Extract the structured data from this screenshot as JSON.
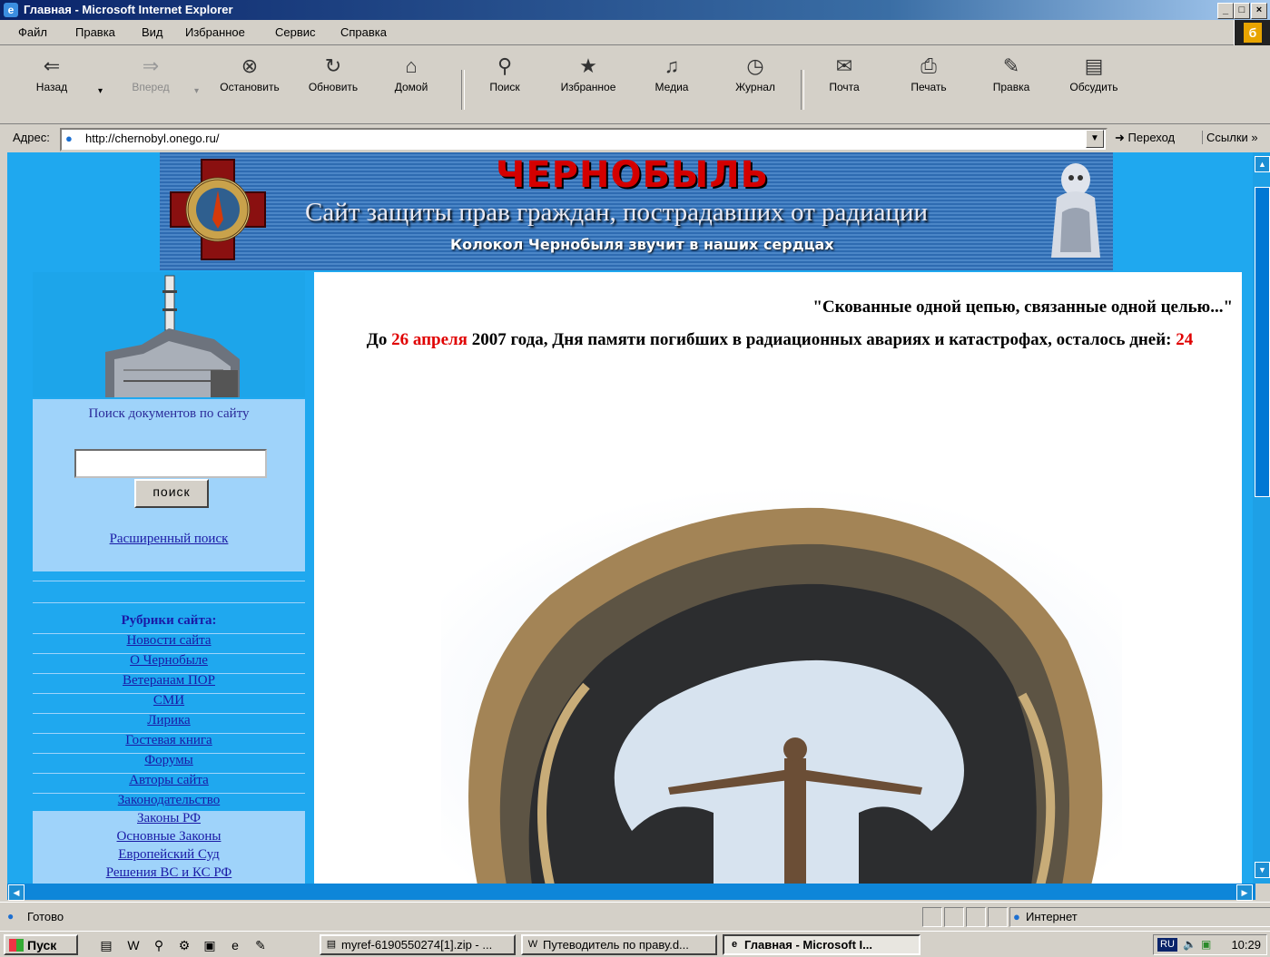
{
  "window": {
    "title": "Главная - Microsoft Internet Explorer"
  },
  "menu": [
    "Файл",
    "Правка",
    "Вид",
    "Избранное",
    "Сервис",
    "Справка"
  ],
  "toolbar": {
    "back": "Назад",
    "forward": "Вперед",
    "stop": "Остановить",
    "refresh": "Обновить",
    "home": "Домой",
    "search": "Поиск",
    "favorites": "Избранное",
    "media": "Медиа",
    "history": "Журнал",
    "mail": "Почта",
    "print": "Печать",
    "edit": "Правка",
    "discuss": "Обсудить"
  },
  "address": {
    "label": "Адрес:",
    "url": "http://chernobyl.onego.ru/",
    "go": "Переход",
    "links": "Ссылки"
  },
  "banner": {
    "title": "ЧЕРНОБЫЛЬ",
    "subtitle": "Сайт защиты прав граждан, пострадавших от радиации",
    "tagline": "Колокол Чернобыля звучит в наших сердцах"
  },
  "sidebar": {
    "search_title": "Поиск документов по сайту",
    "search_button": "поиск",
    "advanced_search": "Расширенный поиск",
    "rubrics_heading": "Рубрики сайта:",
    "rubrics": [
      "Новости сайта",
      "О Чернобыле",
      "Ветеранам ПОР",
      "СМИ",
      "Лирика",
      "Гостевая книга",
      "Форумы",
      "Авторы сайта",
      "Законодательство"
    ],
    "laws": [
      "Законы РФ",
      "Основные Законы",
      "Европейский Суд",
      "Решения ВС и КС РФ"
    ]
  },
  "main": {
    "quote": "\"Скованные одной цепью, связанные одной целью...\"",
    "countdown_pre": "До ",
    "countdown_date": "26 апреля",
    "countdown_mid": " 2007 года, Дня памяти погибших в радиационных авариях и катастрофах, осталось дней: ",
    "countdown_days": "24"
  },
  "status": {
    "text": "Готово",
    "zone": "Интернет"
  },
  "taskbar": {
    "start": "Пуск",
    "tasks": [
      "myref-6190550274[1].zip - ...",
      "Путеводитель по праву.d...",
      "Главная - Microsoft I..."
    ],
    "lang": "RU",
    "clock": "10:29"
  },
  "colors": {
    "page_bg": "#1fa8ef",
    "sidebar_light": "#9fd3fa",
    "link": "#1a1aa6",
    "accent_red": "#e00000"
  }
}
